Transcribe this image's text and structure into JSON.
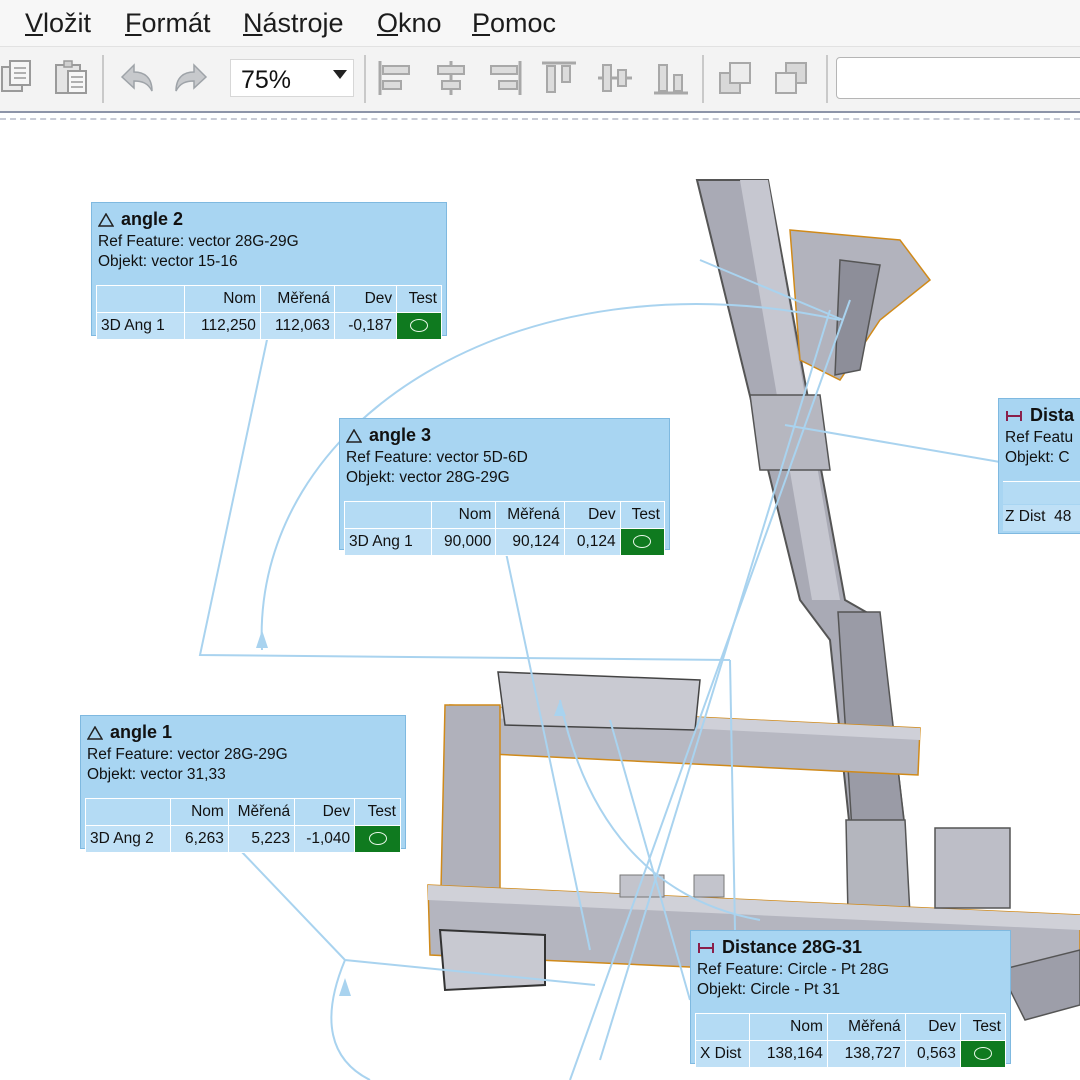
{
  "menu": {
    "items": [
      {
        "label": "Vložit",
        "underline": "V",
        "rest": "ložit"
      },
      {
        "label": "Formát",
        "underline": "F",
        "rest": "ormát"
      },
      {
        "label": "Nástroje",
        "underline": "N",
        "rest": "ástroje"
      },
      {
        "label": "Okno",
        "underline": "O",
        "rest": "kno"
      },
      {
        "label": "Pomoc",
        "underline": "P",
        "rest": "omoc"
      }
    ]
  },
  "toolbar": {
    "zoom_value": "75%",
    "icons": [
      "copy-icon",
      "paste-icon",
      "undo-icon",
      "redo-icon",
      "align-left-icon",
      "align-center-icon",
      "align-right-icon",
      "align-top-icon",
      "align-middle-icon",
      "align-bottom-icon",
      "bring-forward-icon",
      "send-backward-icon"
    ]
  },
  "labels": {
    "angle2": {
      "title": "angle 2",
      "ref": "Ref Feature: vector 28G-29G",
      "obj": "Objekt: vector 15-16",
      "headers": [
        "Nom",
        "Měřená",
        "Dev",
        "Test"
      ],
      "row": {
        "name": "3D Ang 1",
        "nom": "112,250",
        "meas": "112,063",
        "dev": "-0,187"
      }
    },
    "angle3": {
      "title": "angle 3",
      "ref": "Ref Feature: vector 5D-6D",
      "obj": "Objekt: vector 28G-29G",
      "headers": [
        "Nom",
        "Měřená",
        "Dev",
        "Test"
      ],
      "row": {
        "name": "3D Ang 1",
        "nom": "90,000",
        "meas": "90,124",
        "dev": "0,124"
      }
    },
    "angle1": {
      "title": "angle 1",
      "ref": "Ref Feature: vector 28G-29G",
      "obj": "Objekt: vector 31,33",
      "headers": [
        "Nom",
        "Měřená",
        "Dev",
        "Test"
      ],
      "row": {
        "name": "3D Ang 2",
        "nom": "6,263",
        "meas": "5,223",
        "dev": "-1,040"
      }
    },
    "dist1": {
      "title": "Distance 28G-31",
      "ref": "Ref Feature: Circle - Pt 28G",
      "obj": "Objekt: Circle - Pt 31",
      "headers": [
        "Nom",
        "Měřená",
        "Dev",
        "Test"
      ],
      "row": {
        "name": "X Dist",
        "nom": "138,164",
        "meas": "138,727",
        "dev": "0,563"
      }
    },
    "dist2": {
      "title": "Dista",
      "ref": "Ref Featu",
      "obj": "Objekt: C",
      "row": {
        "name": "Z Dist",
        "nom": "48"
      }
    }
  },
  "colors": {
    "label_bg": "#a8d5f2",
    "pass_green": "#0f7a1f",
    "leader_line": "#a9d3ef"
  }
}
